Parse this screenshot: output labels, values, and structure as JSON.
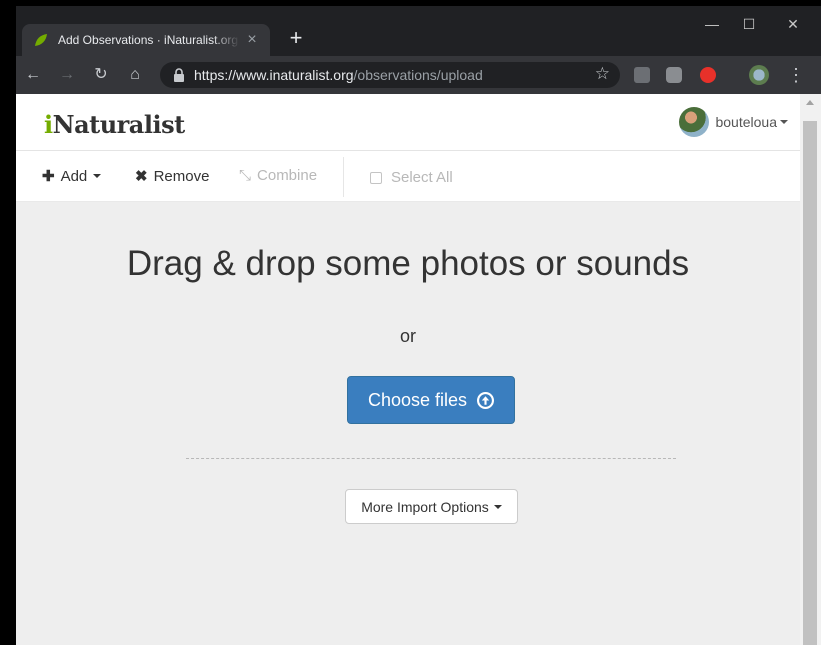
{
  "browser": {
    "tab_title": "Add Observations · iNaturalist.org",
    "tab_close": "×",
    "new_tab": "+",
    "window_controls": {
      "minimize": "—",
      "maximize": "☐",
      "close": "✕"
    },
    "nav": {
      "back": "←",
      "forward": "→",
      "reload": "↻",
      "home": "⌂"
    },
    "url_scheme": "https://",
    "url_host": "www.inaturalist.org",
    "url_path": "/observations/upload",
    "bookmark_star": "☆",
    "menu": "⋮",
    "colors": {
      "frame": "#202124",
      "toolbar": "#35363a"
    }
  },
  "site": {
    "logo_i": "i",
    "logo_rest": "Naturalist",
    "username": "bouteloua",
    "colors": {
      "brand": "#74ac00",
      "primary_button": "#3a7ebf"
    }
  },
  "actions": {
    "add": "Add",
    "remove": "Remove",
    "combine": "Combine",
    "select_all": "Select All"
  },
  "upload": {
    "heading": "Drag & drop some photos or sounds",
    "or": "or",
    "choose_files": "Choose files",
    "more_import": "More Import Options"
  }
}
